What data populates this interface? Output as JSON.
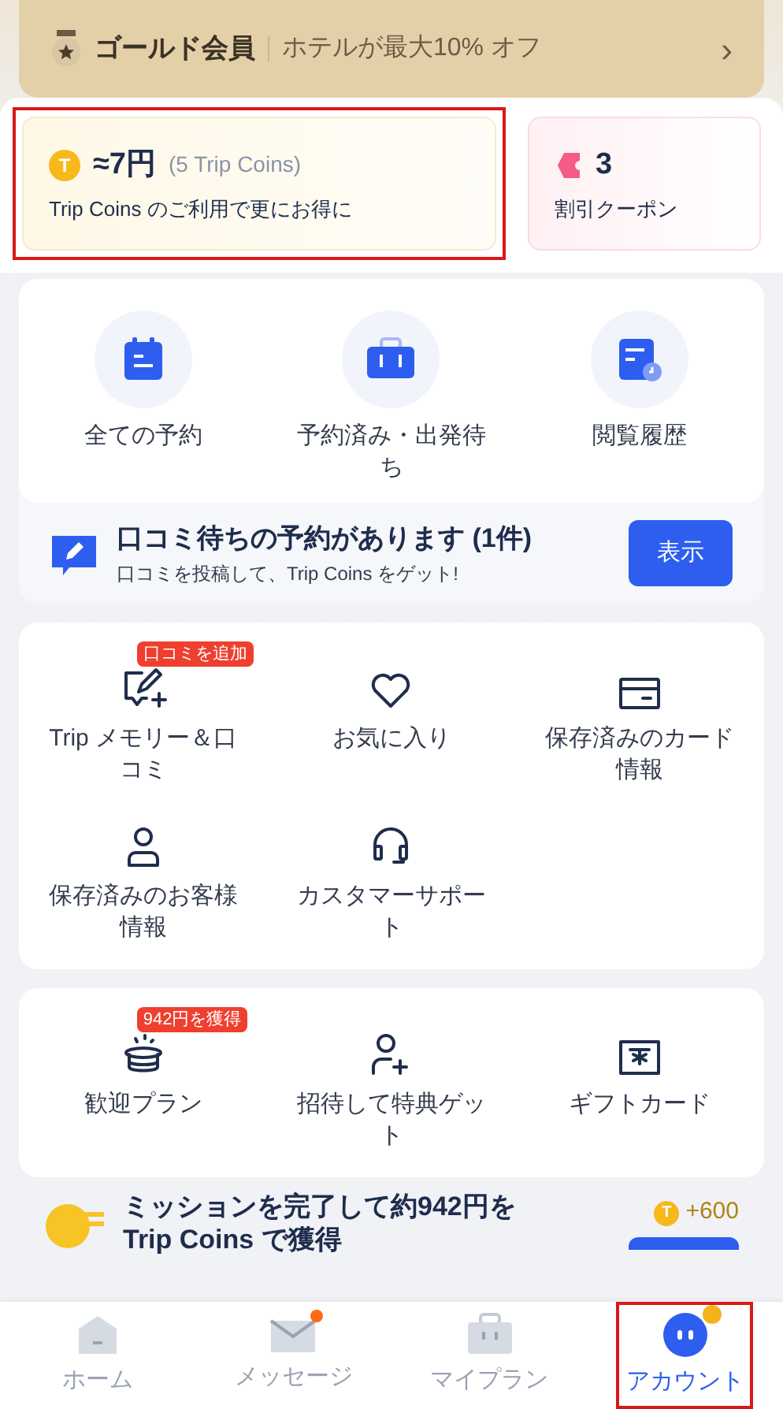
{
  "membership": {
    "tier": "ゴールド会員",
    "benefit": "ホテルが最大10% オフ",
    "chevron": "›"
  },
  "coins": {
    "icon": "T",
    "amount": "≈7円",
    "detail": "(5 Trip Coins)",
    "caption": "Trip Coins のご利用で更にお得に",
    "highlighted": true
  },
  "coupons": {
    "count": "3",
    "label": "割引クーポン",
    "highlighted": false
  },
  "bookings": [
    {
      "label": "全ての予約",
      "kind": "calendar"
    },
    {
      "label": "予約済み・出発待ち",
      "kind": "suitcase"
    },
    {
      "label": "閲覧履歴",
      "kind": "history"
    }
  ],
  "review_prompt": {
    "title": "口コミ待ちの予約があります (1件)",
    "subtitle": "口コミを投稿して、Trip Coins をゲット!",
    "button": "表示"
  },
  "services": [
    {
      "label": "Trip メモリー＆口コミ",
      "kind": "review",
      "badge": "口コミを追加"
    },
    {
      "label": "お気に入り",
      "kind": "heart"
    },
    {
      "label": "保存済みのカード情報",
      "kind": "card"
    },
    {
      "label": "保存済みのお客様情報",
      "kind": "person"
    },
    {
      "label": "カスタマーサポート",
      "kind": "headset"
    }
  ],
  "rewards": [
    {
      "label": "歓迎プラン",
      "kind": "hat",
      "badge": "942円を獲得"
    },
    {
      "label": "招待して特典ゲット",
      "kind": "invite"
    },
    {
      "label": "ギフトカード",
      "kind": "gift"
    }
  ],
  "mission": {
    "title": "ミッションを完了して約942円を",
    "subtitle": "Trip Coins で獲得",
    "coin_icon": "T",
    "reward": "+600"
  },
  "nav": [
    {
      "label": "ホーム",
      "kind": "home",
      "selected": false,
      "highlighted": false,
      "dot": false
    },
    {
      "label": "メッセージ",
      "kind": "mail",
      "selected": false,
      "highlighted": false,
      "dot": true
    },
    {
      "label": "マイプラン",
      "kind": "bag",
      "selected": false,
      "highlighted": false,
      "dot": false
    },
    {
      "label": "アカウント",
      "kind": "account",
      "selected": true,
      "highlighted": true,
      "dot": true
    }
  ]
}
